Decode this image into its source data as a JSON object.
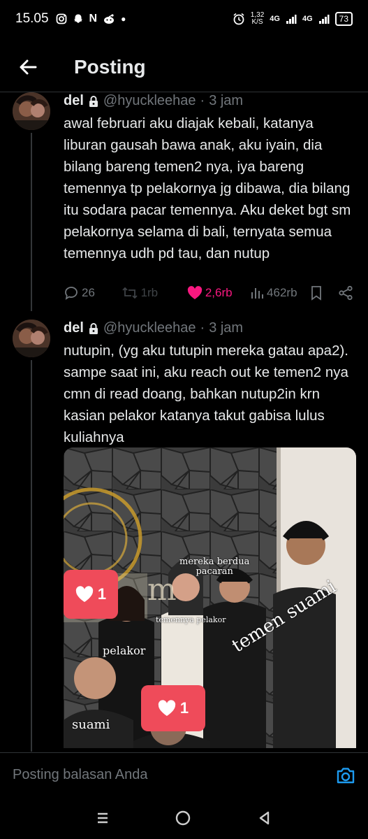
{
  "status_bar": {
    "time": "15.05",
    "net_speed": "1,32",
    "net_unit": "K/S",
    "net1": "4G",
    "net2": "4G",
    "battery": "73"
  },
  "header": {
    "title": "Posting"
  },
  "tweets": [
    {
      "name": "del",
      "handle": "@hyuckleehae",
      "separator": "·",
      "time": "3 jam",
      "text": "awal februari aku diajak kebali, katanya liburan gausah bawa anak, aku iyain, dia bilang bareng temen2 nya, iya bareng temennya tp pelakornya jg dibawa, dia bilang itu sodara pacar temennya. Aku deket bgt sm pelakornya selama di bali, ternyata semua temennya udh pd tau, dan nutup",
      "replies": "26",
      "reposts": "1rb",
      "likes": "2,6rb",
      "views": "462rb"
    },
    {
      "name": "del",
      "handle": "@hyuckleehae",
      "separator": "·",
      "time": "3 jam",
      "text": "nutupin, (yg aku tutupin mereka gatau apa2). sampe saat ini, aku reach out ke temen2 nya cmn di read doang, bahkan nutup2in krn kasian pelakor katanya takut gabisa lulus kuliahnya",
      "photo": {
        "captions": {
          "couple": "mereka berdua\npacaran",
          "pelakor": "pelakor",
          "temennya": "temennya pelakor",
          "temen_suami": "temen suami",
          "suami": "suami"
        },
        "sticker1": "1",
        "sticker2": "1",
        "sign_fragment": "m"
      }
    }
  ],
  "reply": {
    "placeholder": "Posting balasan Anda"
  },
  "colors": {
    "like": "#f91880",
    "accent": "#1d9bf0",
    "muted": "#71767b"
  }
}
